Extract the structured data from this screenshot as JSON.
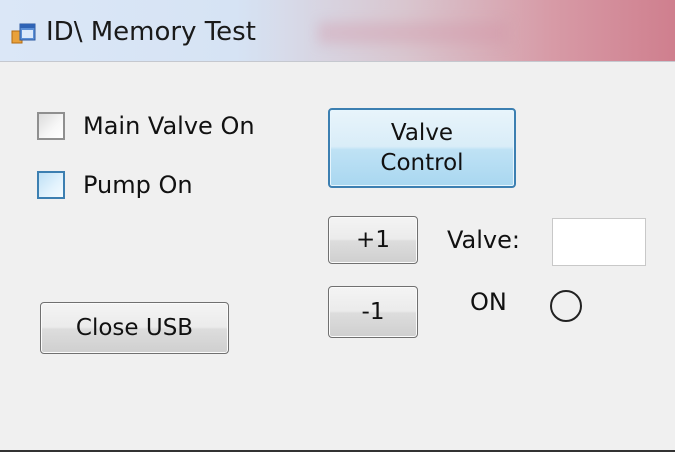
{
  "window": {
    "title": "ID\\ Memory Test",
    "app_icon": "app-window-icon"
  },
  "checkboxes": {
    "main_valve": {
      "label": "Main Valve On",
      "checked": false
    },
    "pump": {
      "label": "Pump On",
      "checked": false
    }
  },
  "buttons": {
    "valve_control": {
      "line1": "Valve",
      "line2": "Control"
    },
    "plus_one": "+1",
    "minus_one": "-1",
    "close_usb": "Close USB"
  },
  "valve": {
    "label": "Valve:",
    "value": ""
  },
  "status": {
    "label": "ON",
    "indicator_on": false
  },
  "colors": {
    "focus_accent": "#3c7fb1",
    "window_bg": "#f0f0f0"
  }
}
